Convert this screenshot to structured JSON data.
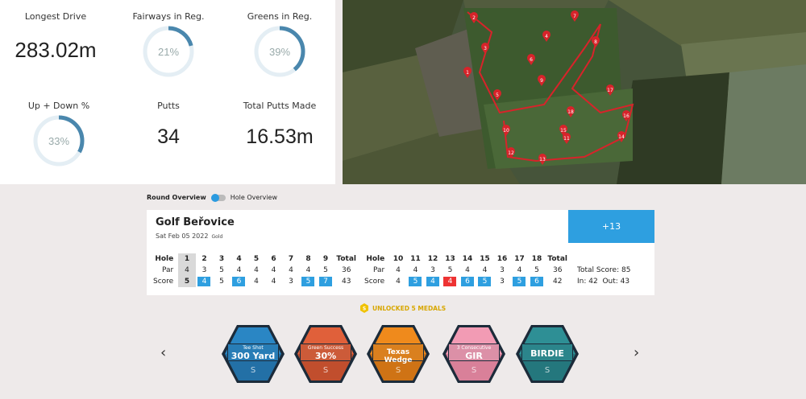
{
  "stats": [
    {
      "label": "Longest Drive",
      "value": "283.02m"
    },
    {
      "label": "Fairways in Reg.",
      "value": "21%",
      "pct": 0.21
    },
    {
      "label": "Greens in Reg.",
      "value": "39%",
      "pct": 0.39
    },
    {
      "label": "Up + Down %",
      "value": "33%",
      "pct": 0.33
    },
    {
      "label": "Putts",
      "value": "34"
    },
    {
      "label": "Total Putts Made",
      "value": "16.53m"
    }
  ],
  "map": {
    "holes": [
      "1",
      "2",
      "3",
      "4",
      "5",
      "6",
      "7",
      "8",
      "9",
      "10",
      "11",
      "12",
      "13",
      "14",
      "15",
      "16",
      "17",
      "18"
    ],
    "marker_color": "#d8232a"
  },
  "view_toggle": {
    "round": "Round Overview",
    "hole": "Hole Overview"
  },
  "round": {
    "course": "Golf Beřovice",
    "date": "Sat Feb 05 2022",
    "tee": "Gold",
    "score_to_par": "+13"
  },
  "front": {
    "hole_label": "Hole",
    "par_label": "Par",
    "score_label": "Score",
    "total_label": "Total",
    "holes": [
      "1",
      "2",
      "3",
      "4",
      "5",
      "6",
      "7",
      "8",
      "9"
    ],
    "par": [
      "4",
      "3",
      "5",
      "4",
      "4",
      "4",
      "4",
      "4",
      "5"
    ],
    "score": [
      "5",
      "4",
      "5",
      "6",
      "4",
      "4",
      "3",
      "5",
      "7"
    ],
    "score_style": [
      "grey",
      "blue",
      "",
      "blue",
      "",
      "",
      "",
      "blue",
      "blue"
    ],
    "par_total": "36",
    "score_total": "43"
  },
  "back": {
    "hole_label": "Hole",
    "par_label": "Par",
    "score_label": "Score",
    "total_label": "Total",
    "holes": [
      "10",
      "11",
      "12",
      "13",
      "14",
      "15",
      "16",
      "17",
      "18"
    ],
    "par": [
      "4",
      "4",
      "3",
      "5",
      "4",
      "4",
      "3",
      "4",
      "5"
    ],
    "score": [
      "4",
      "5",
      "4",
      "4",
      "6",
      "5",
      "3",
      "5",
      "6"
    ],
    "score_style": [
      "",
      "blue",
      "blue",
      "red",
      "blue",
      "blue",
      "",
      "blue",
      "blue"
    ],
    "par_total": "36",
    "score_total": "42"
  },
  "totals": {
    "total_score": "Total Score: 85",
    "in": "In: 42",
    "out": "Out: 43"
  },
  "medals_header": "UNLOCKED 5 MEDALS",
  "medals": [
    {
      "big": "300 Yard",
      "small": "Tee Shot",
      "color": "#2a86c4",
      "dark": "#1d5f8e"
    },
    {
      "big": "30%",
      "small": "Green Success",
      "color": "#e0603a",
      "dark": "#a83f22"
    },
    {
      "big": "Texas Wedge",
      "small": "",
      "color": "#ef8a1c",
      "dark": "#b56110"
    },
    {
      "big": "GIR",
      "small": "3 Consecutive",
      "color": "#f29bb4",
      "dark": "#c46a84"
    },
    {
      "big": "BIRDIE",
      "small": "",
      "color": "#2e8f95",
      "dark": "#1d6469"
    }
  ]
}
